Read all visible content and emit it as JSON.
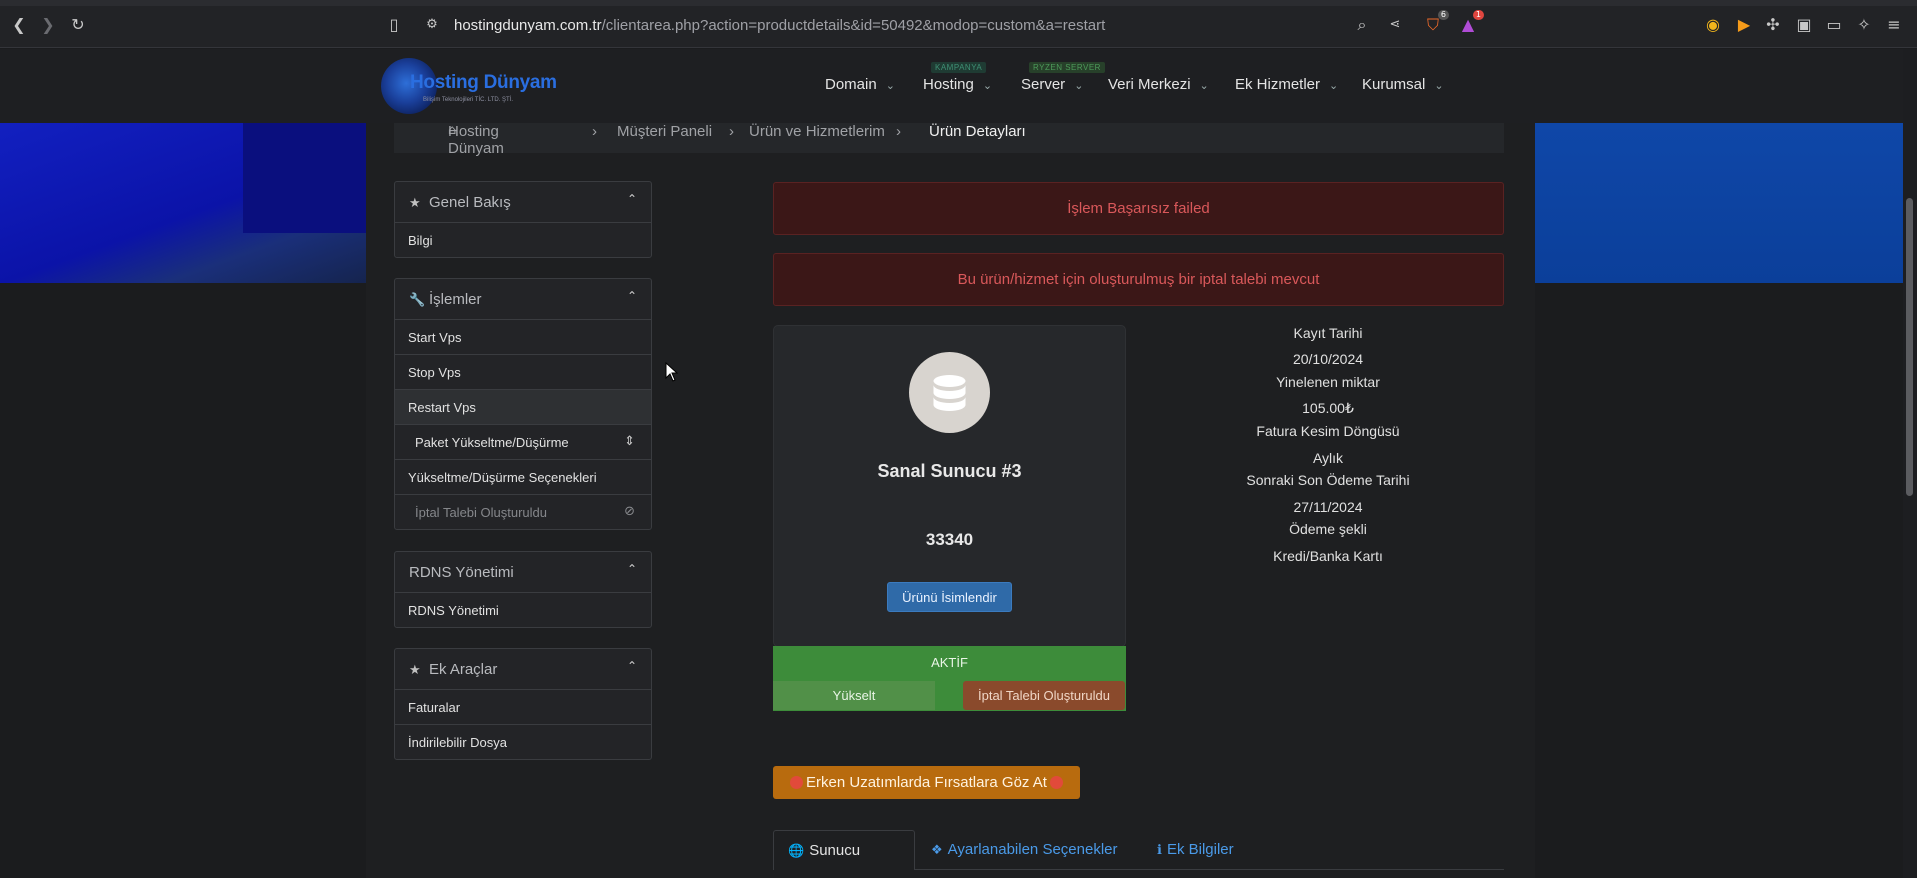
{
  "browser": {
    "url_host": "hostingdunyam.com.tr",
    "url_path": "/clientarea.php?action=productdetails&id=50492&modop=custom&a=restart",
    "brave_badge": "6",
    "alert_badge": "1"
  },
  "site": {
    "logo_title": "Hosting Dünyam",
    "logo_sub": "Bilişim Teknolojileri TİC. LTD. ŞTİ.",
    "nav": [
      {
        "label": "Domain"
      },
      {
        "label": "Hosting",
        "tag": "KAMPANYA"
      },
      {
        "label": "Server",
        "tag": "RYZEN SERVER"
      },
      {
        "label": "Veri Merkezi"
      },
      {
        "label": "Ek Hizmetler"
      },
      {
        "label": "Kurumsal"
      }
    ]
  },
  "breadcrumb": {
    "home": "Hosting Dünyam",
    "sep": "›",
    "items": [
      "Müşteri Paneli",
      "Ürün ve Hizmetlerim",
      "Ürün Detayları"
    ]
  },
  "sidebar": {
    "overview": {
      "title": "Genel Bakış",
      "items": [
        "Bilgi"
      ]
    },
    "actions": {
      "title": "İşlemler",
      "items": [
        "Start Vps",
        "Stop Vps",
        "Restart Vps",
        "Paket Yükseltme/Düşürme",
        "Yükseltme/Düşürme Seçenekleri",
        "İptal Talebi Oluşturuldu"
      ]
    },
    "rdns": {
      "title": "RDNS Yönetimi",
      "items": [
        "RDNS Yönetimi"
      ]
    },
    "tools": {
      "title": "Ek Araçlar",
      "items": [
        "Faturalar",
        "İndirilebilir Dosya"
      ]
    }
  },
  "alerts": {
    "error": "İşlem Başarısız failed",
    "cancel_notice": "Bu ürün/hizmet için oluşturulmuş bir iptal talebi mevcut"
  },
  "product": {
    "name": "Sanal Sunucu #3",
    "number": "33340",
    "rename_button": "Ürünü İsimlendir",
    "status": "AKTİF",
    "upgrade_button": "Yükselt",
    "cancel_button": "İptal Talebi Oluşturuldu"
  },
  "details": {
    "reg_label": "Kayıt Tarihi",
    "reg_value": "20/10/2024",
    "amount_label": "Yinelenen miktar",
    "amount_value": "105.00₺",
    "cycle_label": "Fatura Kesim Döngüsü",
    "cycle_value": "Aylık",
    "due_label": "Sonraki Son Ödeme Tarihi",
    "due_value": "27/11/2024",
    "pay_label": "Ödeme şekli",
    "pay_value": "Kredi/Banka Kartı"
  },
  "promo": "Erken Uzatımlarda Fırsatlara Göz At",
  "tabs": [
    "Sunucu Bilgisi",
    "Ayarlanabilen Seçenekler",
    "Ek Bilgiler"
  ],
  "colors": {
    "accent_blue": "#2f6aa8",
    "active_green": "#3d8c3a",
    "cancel_brown": "#8a4a2c",
    "error_red": "#d9585a",
    "promo_orange": "#b86b0e"
  }
}
